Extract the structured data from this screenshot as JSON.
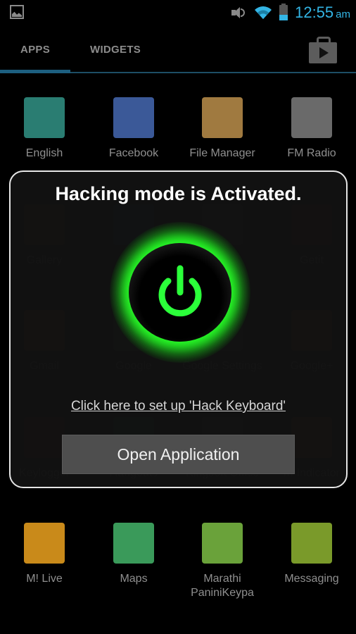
{
  "status_bar": {
    "notification_icon": "gallery-icon",
    "icons": [
      "volume-icon",
      "wifi-icon",
      "battery-icon"
    ],
    "time": "12:55",
    "ampm": "am",
    "accent": "#33b5e5"
  },
  "tabs": [
    {
      "label": "APPS",
      "active": true
    },
    {
      "label": "WIDGETS",
      "active": false
    }
  ],
  "store_icon": "play-store-icon",
  "apps": [
    {
      "label": "English",
      "icon": "english-dictionary-icon",
      "color": "#2a7d72"
    },
    {
      "label": "Facebook",
      "icon": "facebook-icon",
      "color": "#3b5998"
    },
    {
      "label": "File Manager",
      "icon": "file-manager-icon",
      "color": "#a07a40"
    },
    {
      "label": "FM Radio",
      "icon": "fm-radio-icon",
      "color": "#6a6a6a"
    },
    {
      "label": "Gallery",
      "icon": "gallery-app-icon",
      "color": "#8a3a2a"
    },
    {
      "label": "Ga",
      "icon": "app-icon",
      "color": "#2a4a7a"
    },
    {
      "label": "1",
      "icon": "app-icon",
      "color": "#555555"
    },
    {
      "label": "Getit",
      "icon": "getit-icon",
      "color": "#a02a20"
    },
    {
      "label": "Gmail",
      "icon": "gmail-icon",
      "color": "#c0392b"
    },
    {
      "label": "Google",
      "icon": "google-icon",
      "color": "#3a6a3a"
    },
    {
      "label": "Google Settings",
      "icon": "google-settings-icon",
      "color": "#555555"
    },
    {
      "label": "Google+",
      "icon": "google-plus-icon",
      "color": "#c0392b"
    },
    {
      "label": "Keylogger",
      "icon": "keylogger-icon",
      "color": "#8a2a20"
    },
    {
      "label": "Hangouts",
      "icon": "hangouts-icon",
      "color": "#2a8a3a"
    },
    {
      "label": "Kingsoft Office",
      "icon": "kingsoft-office-icon",
      "color": "#555555"
    },
    {
      "label": "m-Indicator",
      "icon": "m-indicator-icon",
      "color": "#c0392b"
    },
    {
      "label": "M! Live",
      "icon": "m-live-icon",
      "color": "#c98a1a"
    },
    {
      "label": "Maps",
      "icon": "maps-icon",
      "color": "#3a9a5a"
    },
    {
      "label": "Marathi PaniniKeypa",
      "icon": "marathi-keypad-icon",
      "color": "#6aa23a"
    },
    {
      "label": "Messaging",
      "icon": "messaging-icon",
      "color": "#7a9a2a"
    }
  ],
  "dialog": {
    "title": "Hacking mode is Activated.",
    "power_icon": "power-icon",
    "power_state": "on",
    "glow_color": "#22ee22",
    "setup_link": "Click here to set up 'Hack Keyboard'",
    "open_button": "Open Application"
  }
}
